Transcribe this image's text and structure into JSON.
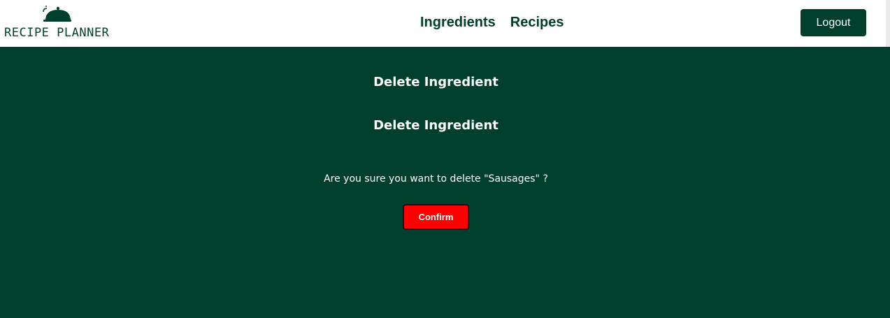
{
  "colors": {
    "brand": "#003f2b",
    "background": "#003f2b",
    "danger": "#ff0000",
    "navbar": "#ffffff"
  },
  "header": {
    "logo_text": "RECIPE PLANNER",
    "logo_icon": "cloche-icon",
    "nav": [
      {
        "label": "Ingredients"
      },
      {
        "label": "Recipes"
      }
    ],
    "logout_label": "Logout"
  },
  "main": {
    "title": "Delete Ingredient",
    "subtitle": "Delete Ingredient",
    "question": "Are you sure you want to delete \"Sausages\" ?",
    "confirm_label": "Confirm"
  }
}
